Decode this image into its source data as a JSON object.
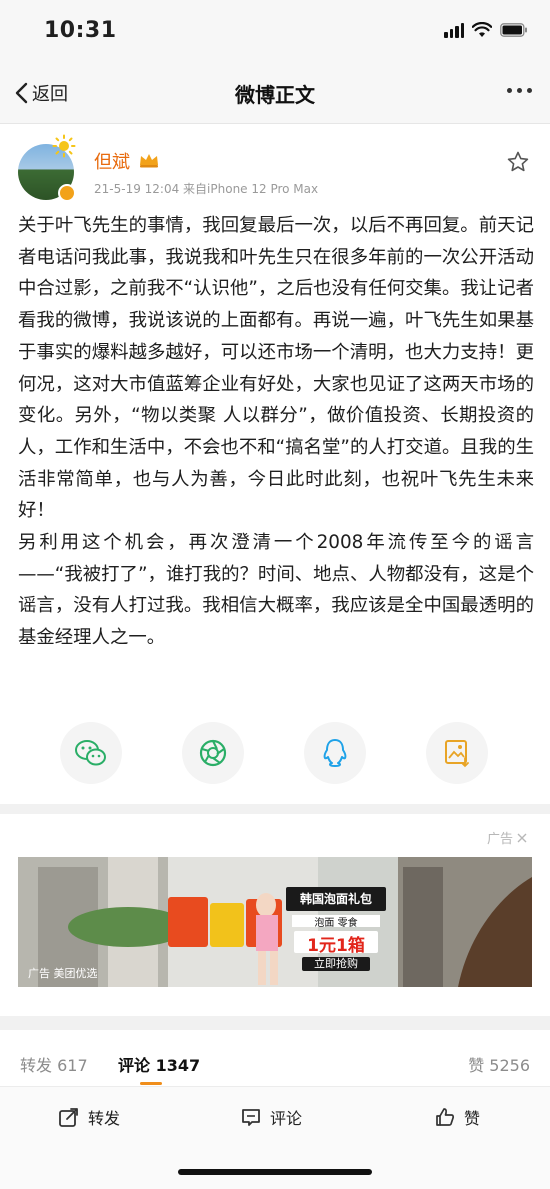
{
  "status_bar": {
    "time": "10:31"
  },
  "nav": {
    "back_label": "返回",
    "title": "微博正文"
  },
  "author": {
    "name": "但斌",
    "meta": "21-5-19 12:04  来自iPhone 12 Pro Max"
  },
  "post": {
    "paragraphs": [
      "关于叶飞先生的事情，我回复最后一次，以后不再回复。前天记者电话问我此事，我说我和叶先生只在很多年前的一次公开活动中合过影，之前我不“认识他”，之后也没有任何交集。我让记者看我的微博，我说该说的上面都有。再说一遍，叶飞先生如果基于事实的爆料越多越好，可以还市场一个清明，也大力支持！更何况，这对大市值蓝筹企业有好处，大家也见证了这两天市场的变化。另外，“物以类聚 人以群分”，做价值投资、长期投资的人，工作和生活中，不会也不和“搞名堂”的人打交道。且我的生活非常简单，也与人为善，今日此时此刻，也祝叶飞先生未来好！",
      "另利用这个机会，再次澄清一个2008年流传至今的谣言——“我被打了”，谁打我的？时间、地点、人物都没有，这是个谣言，没有人打过我。我相信大概率，我应该是全中国最透明的基金经理人之一。"
    ]
  },
  "share": {
    "icons": [
      "wechat-icon",
      "moments-icon",
      "qq-icon",
      "save-image-icon"
    ]
  },
  "ad": {
    "label": "广告",
    "banner_headline": "韩国泡面礼包",
    "banner_sub": "泡面 零食",
    "banner_price": "1元1箱",
    "banner_cta": "立即抢购",
    "footer": "广告  美团优选"
  },
  "stats": {
    "repost": "转发 617",
    "comment": "评论 1347",
    "like": "赞 5256"
  },
  "actions": {
    "repost": "转发",
    "comment": "评论",
    "like": "赞"
  },
  "colors": {
    "accent": "#f08e1b",
    "username": "#e86b0e",
    "meta": "#9a9a9a",
    "wechat": "#2aae67",
    "qq": "#1fa2e8"
  }
}
